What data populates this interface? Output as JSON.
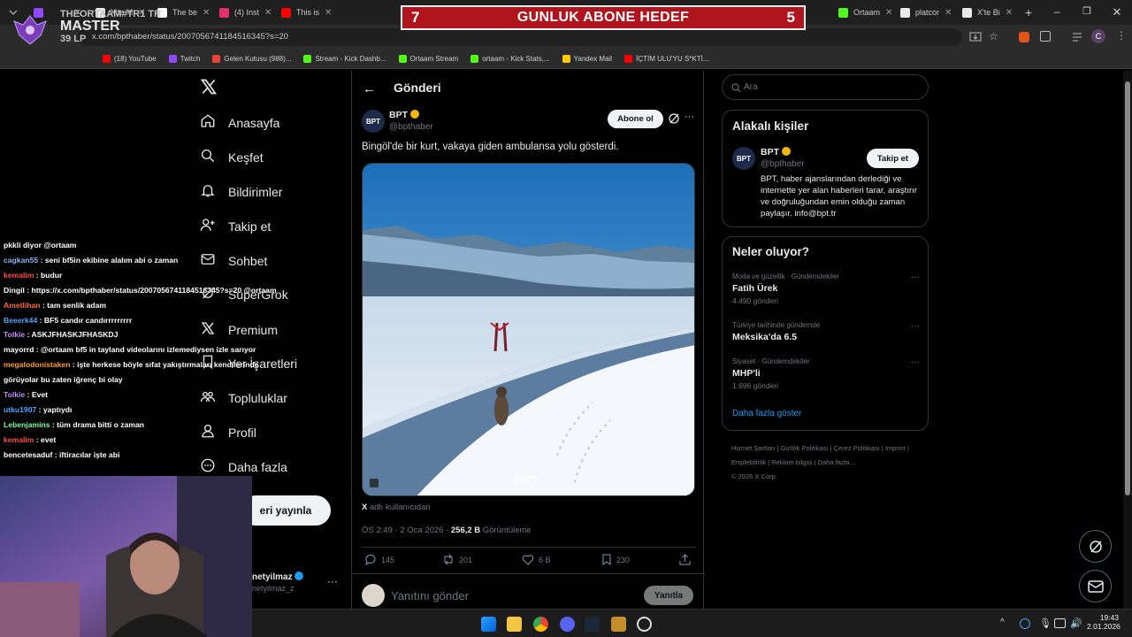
{
  "browser": {
    "tabs": [
      {
        "label": "",
        "color": "#9146ff"
      },
      {
        "label": "X'te M",
        "color": "#e7e9ea"
      },
      {
        "label": "The be",
        "color": "#ffffff"
      },
      {
        "label": "(4) Inst",
        "color": "#e1306c"
      },
      {
        "label": "This is",
        "color": "#ff0000"
      },
      {
        "label": "Ortaam",
        "color": "#53fc18"
      },
      {
        "label": "platcor",
        "color": "#e7e9ea"
      },
      {
        "label": "X'te Bi",
        "color": "#e7e9ea"
      }
    ],
    "url": "x.com/bpthaber/status/2007056741184516345?s=20",
    "profile_initial": "C",
    "bookmarks": [
      {
        "label": "(18) YouTube",
        "color": "#ff0000"
      },
      {
        "label": "Twitch",
        "color": "#9146ff"
      },
      {
        "label": "Gelen Kutusu (988)...",
        "color": "#ea4335"
      },
      {
        "label": "Stream - Kick Dashb...",
        "color": "#53fc18"
      },
      {
        "label": "Ortaam Stream",
        "color": "#53fc18"
      },
      {
        "label": "ortaam - Kick Stats,...",
        "color": "#53fc18"
      },
      {
        "label": "Yandex Mail",
        "color": "#ffcc00"
      },
      {
        "label": "İÇTİM ULU'YU S*KTİ...",
        "color": "#ff0000"
      }
    ]
  },
  "overlay": {
    "banner_left": "7",
    "banner_title": "GUNLUK ABONE HEDEF",
    "banner_right": "5",
    "rank_name": "THEORTAAM#TR1 TR",
    "rank_tier": "MASTER",
    "rank_lp": "39 LP"
  },
  "chat": [
    {
      "user": "",
      "user_color": "#ffffff",
      "text": "pkkli diyor @ortaam"
    },
    {
      "user": "cagkan55",
      "user_color": "#8ab4f8",
      "text": ": seni bf5in ekibine alalım abi o zaman"
    },
    {
      "user": "kemalim",
      "user_color": "#ff4d4d",
      "text": ": budur"
    },
    {
      "user": "Dingil",
      "user_color": "#ffffff",
      "text": ": https://x.com/bpthaber/status/2007056741184516345?s=20 @ortaam"
    },
    {
      "user": "Ametlihan",
      "user_color": "#ff6b3d",
      "text": ": tam senlik adam"
    },
    {
      "user": "Beeerk44",
      "user_color": "#4da6ff",
      "text": ": BF5 candır candırrrrrrrrr"
    },
    {
      "user": "Tolkie",
      "user_color": "#c58cff",
      "text": ": ASKJFHASKJFHASKDJ"
    },
    {
      "user": "mayorrd",
      "user_color": "#ffffff",
      "text": ": @ortaam bf5 in tayland videolarını izlemediysen izle sarıyor"
    },
    {
      "user": "megalodonistaken",
      "user_color": "#ff9f1a",
      "text": ": işte herkese böyle sıfat yakıştırmaları kendilerinde"
    },
    {
      "user": "",
      "user_color": "#ffffff",
      "text": "görüyolar bu zaten iğrenç bi olay"
    },
    {
      "user": "Tolkie",
      "user_color": "#c58cff",
      "text": ": Evet"
    },
    {
      "user": "utku1907",
      "user_color": "#4da6ff",
      "text": ": yaptıydı"
    },
    {
      "user": "Lebenjamins",
      "user_color": "#7cfc9a",
      "text": ": tüm drama bitti o zaman"
    },
    {
      "user": "kemalim",
      "user_color": "#ff4d4d",
      "text": ": evet"
    },
    {
      "user": "bencetesaduf",
      "user_color": "#ffffff",
      "text": ": iftiracılar işte abi"
    }
  ],
  "leftnav": {
    "items": [
      {
        "label": "Anasayfa",
        "icon": "home-icon"
      },
      {
        "label": "Keşfet",
        "icon": "search-icon"
      },
      {
        "label": "Bildirimler",
        "icon": "bell-icon"
      },
      {
        "label": "Takip et",
        "icon": "follow-icon"
      },
      {
        "label": "Sohbet",
        "icon": "mail-icon"
      },
      {
        "label": "SuperGrok",
        "icon": "grok-icon"
      },
      {
        "label": "Premium",
        "icon": "x-icon"
      },
      {
        "label": "Yer İşaretleri",
        "icon": "bookmark-icon"
      },
      {
        "label": "Topluluklar",
        "icon": "communities-icon"
      },
      {
        "label": "Profil",
        "icon": "profile-icon"
      },
      {
        "label": "Daha fazla",
        "icon": "more-icon"
      }
    ],
    "post_button": "eri yayınla",
    "account_name": "netyilmaz",
    "account_handle": "netyilmaz_z"
  },
  "main": {
    "header_title": "Gönderi",
    "author_name": "BPT",
    "author_handle": "@bpthaber",
    "subscribe_label": "Abone ol",
    "post_text": "Bingöl'de bir kurt, vakaya giden ambulansa yolu gösterdi.",
    "video_watermark": "BPT",
    "source_prefix": "X",
    "source_text": "adlı kullanıcıdan",
    "timestamp": "ÖS 2:49 · 2 Oca 2026 ·",
    "views": "256,2 B",
    "views_label": "Görüntüleme",
    "actions": {
      "replies": "145",
      "reposts": "201",
      "likes": "6 B",
      "bookmarks": "230"
    },
    "reply_placeholder": "Yanıtını gönder",
    "reply_button": "Yanıtla"
  },
  "sidebar": {
    "search_placeholder": "Ara",
    "relevant_title": "Alakalı kişiler",
    "relevant_name": "BPT",
    "relevant_handle": "@bpthaber",
    "follow_label": "Takip et",
    "relevant_bio": "BPT, haber ajanslarından derlediği ve internette yer alan haberleri tarar, araştırır ve doğruluğundan emin olduğu zaman paylaşır. info@bpt.tr",
    "trends_title": "Neler oluyor?",
    "trends": [
      {
        "context": "Moda ve güzellik · Gündemdekiler",
        "name": "Fatih Ürek",
        "count": "4.490 gönderi"
      },
      {
        "context": "Türkiye tarihinde gündemde",
        "name": "Meksika'da 6.5",
        "count": ""
      },
      {
        "context": "Siyaset · Gündemdekiler",
        "name": "MHP'li",
        "count": "1.696 gönderi"
      }
    ],
    "show_more": "Daha fazla göster",
    "footer_links": [
      "Hizmet Şartları",
      "Gizlilik Politikası",
      "Çerez Politikası",
      "Imprint",
      "Erişilebilirlik",
      "Reklam bilgisi",
      "Daha fazla ..."
    ],
    "copyright": "© 2026 X Corp."
  },
  "taskbar": {
    "time": "19:43",
    "date": "2.01.2026"
  },
  "colors": {
    "verified": "#f2b611",
    "accent": "#1d9bf0",
    "banner": "#b0141c"
  }
}
